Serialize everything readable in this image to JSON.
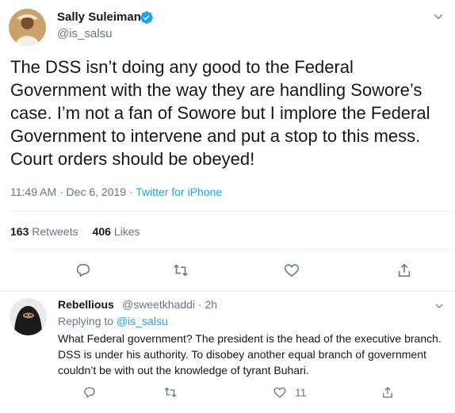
{
  "tweet": {
    "author_name": "Sally Suleiman",
    "author_handle": "@is_salsu",
    "text": "The DSS isn’t doing any good to the Federal Government with the way they are handling Sowore’s case. I’m not a fan of Sowore but I implore the Federal Government to intervene and put a stop to this mess. Court orders should be obeyed!",
    "time": "11:49 AM · Dec 6, 2019 · ",
    "source": "Twitter for iPhone",
    "retweets_count": "163",
    "retweets_label": "Retweets",
    "likes_count": "406",
    "likes_label": "Likes"
  },
  "reply": {
    "author_name": "Rebellious",
    "author_handle": "@sweetkhaddi · 2h",
    "replying_prefix": "Replying to ",
    "replying_to": "@is_salsu",
    "text": "What Federal government? The president is the head of the executive branch. DSS is under his authority. To disobey another equal branch of government couldn’t be with out the knowledge of tyrant Buhari.",
    "like_count": "11"
  },
  "colors": {
    "accent": "#1da1f2",
    "muted": "#657786",
    "text": "#14171a",
    "border": "#e6ecf0"
  },
  "icons": [
    "verified-badge-icon",
    "chevron-down-icon",
    "reply-icon",
    "retweet-icon",
    "like-icon",
    "share-icon"
  ]
}
